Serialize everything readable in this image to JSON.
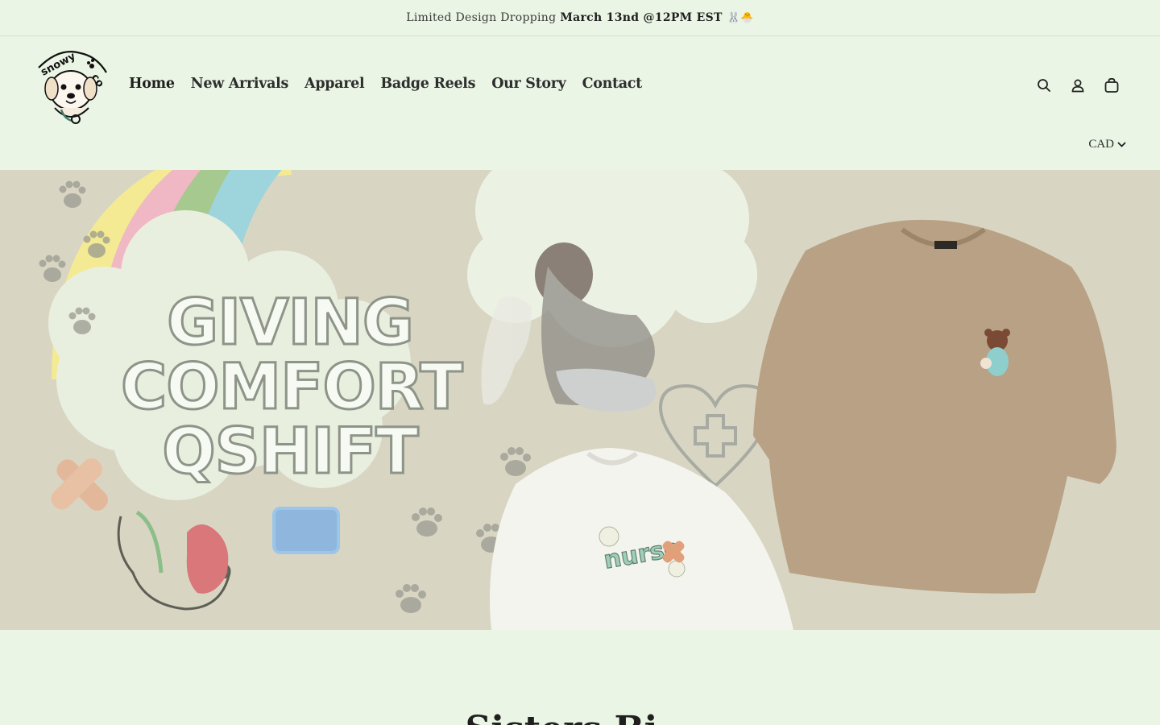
{
  "announcement": {
    "prefix": "Limited Design Dropping",
    "highlight": "March 13nd @12PM EST",
    "emoji": "🐰🐣"
  },
  "brand": {
    "logo_text": "snowy co"
  },
  "nav": {
    "items": [
      {
        "label": "Home"
      },
      {
        "label": "New Arrivals"
      },
      {
        "label": "Apparel"
      },
      {
        "label": "Badge Reels"
      },
      {
        "label": "Our Story"
      },
      {
        "label": "Contact"
      }
    ]
  },
  "header_icons": [
    "search-icon",
    "account-icon",
    "cart-icon"
  ],
  "currency": {
    "selected": "CAD"
  },
  "hero": {
    "headline": [
      "GIVING",
      "COMFORT",
      "QSHIFT"
    ],
    "shirt_print": "nurse"
  },
  "section": {
    "heading": "Sisters Bi..."
  },
  "colors": {
    "page_bg": "#ebf5e5",
    "hero_bg": "#d9d5c3",
    "sweatshirt_tan": "#b8a184",
    "rainbow": [
      "#f3ea93",
      "#f0b7c4",
      "#a6c98f",
      "#9ed4dc"
    ]
  }
}
